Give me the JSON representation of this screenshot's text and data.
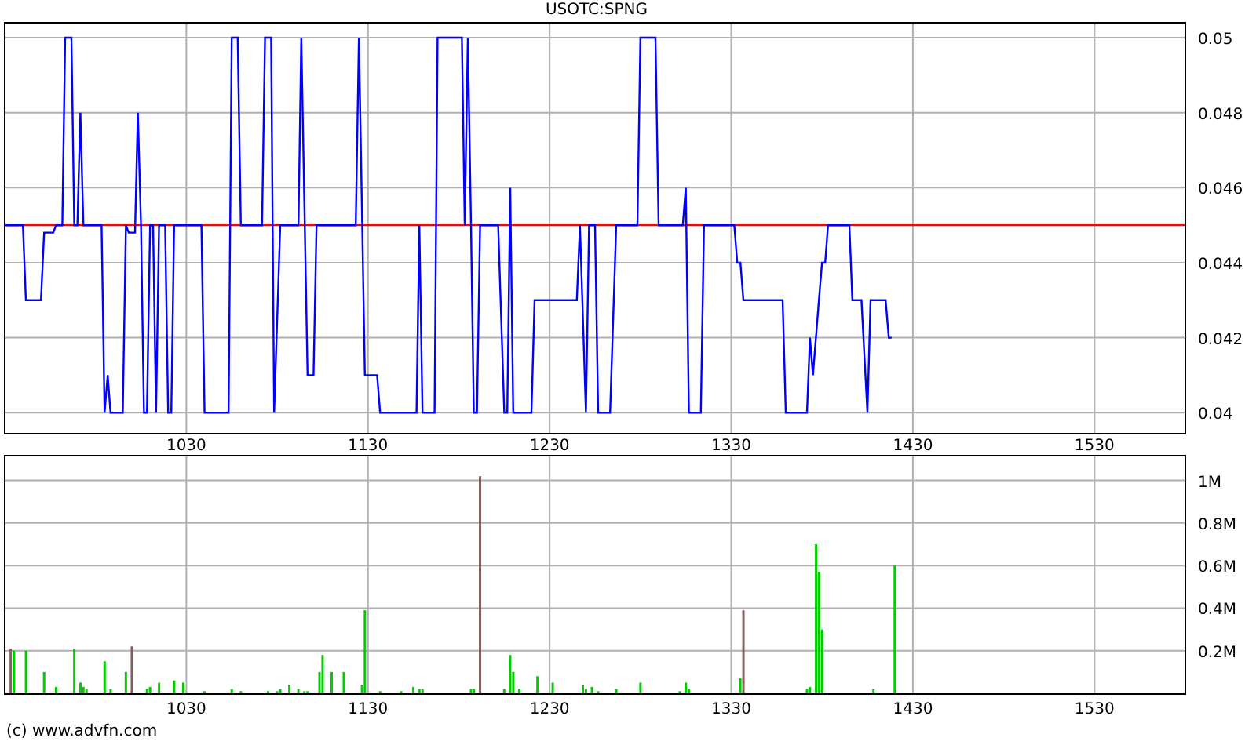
{
  "price_chart": {
    "chart_data": {
      "type": "line",
      "title": "USOTC:SPNG",
      "x": [
        930,
        940,
        941.7,
        950,
        951.7,
        956.7,
        958.3,
        961.7,
        963.3,
        966.7,
        968.3,
        970,
        971.7,
        973.3,
        983.3,
        985,
        986.7,
        988.3,
        995,
        996.7,
        998.3,
        1001.7,
        1003.3,
        1005,
        1006.7,
        1008.3,
        1010,
        1011.7,
        1013.3,
        1015,
        1018.3,
        1020,
        1021.7,
        1023.3,
        1038.3,
        1040,
        1053.3,
        1055,
        1058.3,
        1060,
        1071.7,
        1073.3,
        1076.7,
        1078.3,
        1081.7,
        1091.7,
        1093.3,
        1096.7,
        1100,
        1101.7,
        1123.3,
        1125,
        1128.3,
        1135,
        1136.7,
        1156.7,
        1158.3,
        1160,
        1166.7,
        1168.3,
        1181.7,
        1183.3,
        1185,
        1186.7,
        1188.3,
        1190,
        1191.7,
        1201.7,
        1205,
        1206.7,
        1208.3,
        1210,
        1220,
        1221.7,
        1245,
        1246.7,
        1250,
        1251.7,
        1255,
        1256.7,
        1263.3,
        1266.7,
        1278.3,
        1280,
        1288.3,
        1290,
        1303.3,
        1305,
        1306.7,
        1313.3,
        1315,
        1331.7,
        1333.3,
        1335,
        1336.7,
        1358.3,
        1360,
        1371.7,
        1373.3,
        1375,
        1378.3,
        1380,
        1381.7,
        1383.3,
        1395,
        1396.7,
        1401.7,
        1405,
        1406.7,
        1415,
        1416.7,
        1418.3
      ],
      "series": [
        {
          "color": "#0000ff",
          "values": [
            0.045,
            0.045,
            0.043,
            0.043,
            0.0448,
            0.0448,
            0.045,
            0.045,
            0.05,
            0.05,
            0.045,
            0.045,
            0.048,
            0.045,
            0.045,
            0.04,
            0.041,
            0.04,
            0.04,
            0.045,
            0.0448,
            0.0448,
            0.048,
            0.045,
            0.04,
            0.04,
            0.045,
            0.045,
            0.04,
            0.045,
            0.045,
            0.04,
            0.04,
            0.045,
            0.045,
            0.04,
            0.04,
            0.05,
            0.05,
            0.045,
            0.045,
            0.05,
            0.05,
            0.04,
            0.045,
            0.045,
            0.05,
            0.041,
            0.041,
            0.045,
            0.045,
            0.05,
            0.041,
            0.041,
            0.04,
            0.04,
            0.045,
            0.04,
            0.04,
            0.05,
            0.05,
            0.045,
            0.05,
            0.045,
            0.04,
            0.04,
            0.045,
            0.045,
            0.04,
            0.04,
            0.046,
            0.04,
            0.04,
            0.043,
            0.043,
            0.045,
            0.04,
            0.045,
            0.045,
            0.04,
            0.04,
            0.045,
            0.045,
            0.05,
            0.05,
            0.045,
            0.045,
            0.046,
            0.04,
            0.04,
            0.045,
            0.045,
            0.044,
            0.044,
            0.043,
            0.043,
            0.04,
            0.04,
            0.042,
            0.041,
            0.043,
            0.044,
            0.044,
            0.045,
            0.045,
            0.043,
            0.043,
            0.04,
            0.043,
            0.043,
            0.042,
            0.042
          ]
        }
      ],
      "xlim": [
        930,
        1580
      ],
      "ylim": [
        0.03946,
        0.05042
      ],
      "xticks": [
        1030,
        1130,
        1230,
        1330,
        1430,
        1530
      ],
      "yticks": [
        0.04,
        0.042,
        0.044,
        0.046,
        0.048,
        0.05
      ],
      "grid": true,
      "ref_lines": [
        {
          "axis": "y",
          "value": 0.045,
          "color": "#ff0000"
        }
      ]
    }
  },
  "volume_chart": {
    "chart_data": {
      "type": "bar",
      "x": [
        933.3,
        935,
        941.7,
        951.7,
        958.3,
        968.3,
        971.7,
        973.3,
        975,
        985,
        988.3,
        996.7,
        1000,
        1008.3,
        1010,
        1015,
        1023.3,
        1028.3,
        1040,
        1055,
        1060,
        1075,
        1080,
        1081.7,
        1086.7,
        1091.7,
        1095,
        1096.7,
        1103.3,
        1105,
        1110,
        1116.7,
        1126.7,
        1128.3,
        1136.7,
        1148.3,
        1155,
        1158.3,
        1160,
        1186.7,
        1188.3,
        1191.7,
        1205,
        1208.3,
        1210,
        1213.3,
        1223.3,
        1231.7,
        1248.3,
        1250,
        1253.3,
        1256.7,
        1266.7,
        1280,
        1301.7,
        1305,
        1306.7,
        1335,
        1336.7,
        1371.7,
        1373.3,
        1376.7,
        1378.3,
        1380,
        1408.3,
        1420
      ],
      "series": [
        {
          "color": "#00cc00",
          "values": [
            null,
            0.2,
            0.2,
            0.1,
            0.03,
            0.21,
            0.05,
            0.03,
            0.02,
            0.15,
            0.02,
            0.1,
            null,
            0.02,
            0.03,
            0.05,
            0.06,
            0.05,
            0.01,
            0.02,
            0.01,
            0.01,
            0.01,
            0.02,
            0.04,
            0.02,
            0.01,
            0.01,
            0.1,
            0.18,
            0.1,
            0.1,
            0.04,
            0.39,
            0.01,
            0.01,
            0.03,
            0.02,
            0.02,
            0.02,
            0.02,
            null,
            0.02,
            0.18,
            0.1,
            0.02,
            0.08,
            0.05,
            0.04,
            0.02,
            0.03,
            0.01,
            0.02,
            0.05,
            0.01,
            0.05,
            0.02,
            0.07,
            null,
            0.02,
            0.03,
            0.7,
            0.57,
            0.3,
            0.02,
            0.6
          ]
        },
        {
          "color": "#806060",
          "values": [
            0.21,
            null,
            null,
            null,
            null,
            null,
            null,
            null,
            null,
            null,
            null,
            null,
            0.22,
            null,
            null,
            null,
            null,
            null,
            null,
            null,
            null,
            null,
            null,
            null,
            null,
            null,
            null,
            null,
            null,
            null,
            null,
            null,
            null,
            null,
            null,
            null,
            null,
            null,
            null,
            null,
            null,
            1.02,
            null,
            null,
            null,
            null,
            null,
            null,
            null,
            null,
            null,
            null,
            null,
            null,
            null,
            null,
            null,
            null,
            0.39,
            null,
            null,
            null,
            null,
            null,
            null,
            null
          ]
        }
      ],
      "xlim": [
        930,
        1580
      ],
      "ylim": [
        0,
        1.12
      ],
      "grid": true,
      "xticks": [
        1030,
        1130,
        1230,
        1330,
        1430,
        1530
      ],
      "yticks": [
        {
          "value": 0.2,
          "label": "0.2M"
        },
        {
          "value": 0.4,
          "label": "0.4M"
        },
        {
          "value": 0.6,
          "label": "0.6M"
        },
        {
          "value": 0.8,
          "label": "0.8M"
        },
        {
          "value": 1,
          "label": "1M"
        }
      ]
    }
  },
  "footer": "(c) www.advfn.com"
}
